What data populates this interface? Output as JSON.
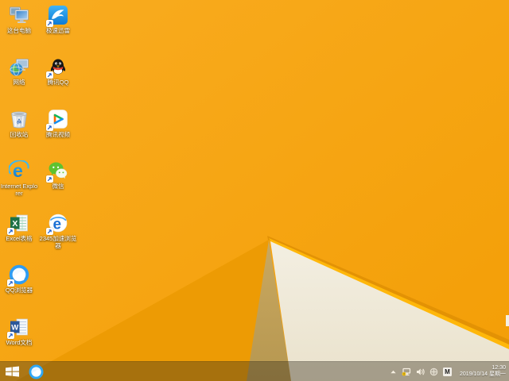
{
  "desktop": {
    "icons": [
      {
        "name": "this-pc",
        "label": "这台电脑"
      },
      {
        "name": "xunlei",
        "label": "极速迅雷"
      },
      {
        "name": "network",
        "label": "网络"
      },
      {
        "name": "tencent-qq",
        "label": "腾讯QQ"
      },
      {
        "name": "recycle-bin",
        "label": "回收站"
      },
      {
        "name": "tencent-video",
        "label": "腾讯视频"
      },
      {
        "name": "internet-explorer",
        "label": "Internet Explorer",
        "letter": "e"
      },
      {
        "name": "wechat",
        "label": "微信"
      },
      {
        "name": "excel",
        "label": "Excel表格",
        "letter": "X"
      },
      {
        "name": "browser-2345",
        "label": "2345加速浏览器",
        "letter": "e"
      },
      {
        "name": "qq-browser",
        "label": "QQ浏览器"
      },
      {
        "name": "word",
        "label": "Word文档",
        "letter": "W"
      }
    ]
  },
  "taskbar": {
    "start_button": "Start",
    "pinned": [
      {
        "name": "qq-browser"
      }
    ],
    "tray": {
      "icons": [
        "hidden-icons-chevron",
        "network-warning",
        "volume",
        "safely-remove-hardware",
        "ime-indicator"
      ],
      "ime": "M",
      "time": "12:30",
      "date": "2019/10/14 星期一"
    }
  },
  "colors": {
    "wallpaper_orange": "#F6A30D",
    "wallpaper_orange_dark": "#ED9B04",
    "wallpaper_tan_facet": "#C3A25C",
    "wallpaper_white_facet": "#F1ECDC",
    "wallpaper_edge_highlight": "#FFB70A",
    "taskbar_overlay": "rgba(52,44,30,0.38)"
  }
}
